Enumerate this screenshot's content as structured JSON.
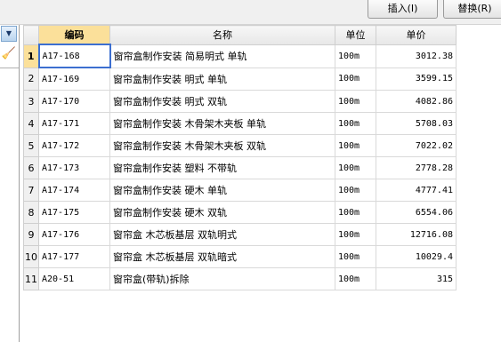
{
  "toolbar": {
    "insert_label": "插入(I)",
    "replace_label": "替换(R)"
  },
  "sidebar": {
    "dropdown_icon": "chevron-down-icon",
    "tool_icon": "broom-icon"
  },
  "table": {
    "headers": {
      "rownum": "",
      "code": "编码",
      "name": "名称",
      "unit": "单位",
      "price": "单价"
    },
    "rows": [
      {
        "n": "1",
        "code": "A17-168",
        "name": "窗帘盒制作安装 简易明式 单轨",
        "unit": "100m",
        "price": "3012.38"
      },
      {
        "n": "2",
        "code": "A17-169",
        "name": "窗帘盒制作安装 明式 单轨",
        "unit": "100m",
        "price": "3599.15"
      },
      {
        "n": "3",
        "code": "A17-170",
        "name": "窗帘盒制作安装 明式 双轨",
        "unit": "100m",
        "price": "4082.86"
      },
      {
        "n": "4",
        "code": "A17-171",
        "name": "窗帘盒制作安装 木骨架木夹板 单轨",
        "unit": "100m",
        "price": "5708.03"
      },
      {
        "n": "5",
        "code": "A17-172",
        "name": "窗帘盒制作安装 木骨架木夹板 双轨",
        "unit": "100m",
        "price": "7022.02"
      },
      {
        "n": "6",
        "code": "A17-173",
        "name": "窗帘盒制作安装 塑料 不带轨",
        "unit": "100m",
        "price": "2778.28"
      },
      {
        "n": "7",
        "code": "A17-174",
        "name": "窗帘盒制作安装 硬木 单轨",
        "unit": "100m",
        "price": "4777.41"
      },
      {
        "n": "8",
        "code": "A17-175",
        "name": "窗帘盒制作安装 硬木 双轨",
        "unit": "100m",
        "price": "6554.06"
      },
      {
        "n": "9",
        "code": "A17-176",
        "name": "窗帘盒 木芯板基层 双轨明式",
        "unit": "100m",
        "price": "12716.08"
      },
      {
        "n": "10",
        "code": "A17-177",
        "name": "窗帘盒 木芯板基层 双轨暗式",
        "unit": "100m",
        "price": "10029.4"
      },
      {
        "n": "11",
        "code": "A20-51",
        "name": "窗帘盒(带轨)拆除",
        "unit": "100m",
        "price": "315"
      }
    ]
  },
  "colors": {
    "header_highlight": "#fbe09a",
    "selection_border": "#3c6fd0"
  }
}
